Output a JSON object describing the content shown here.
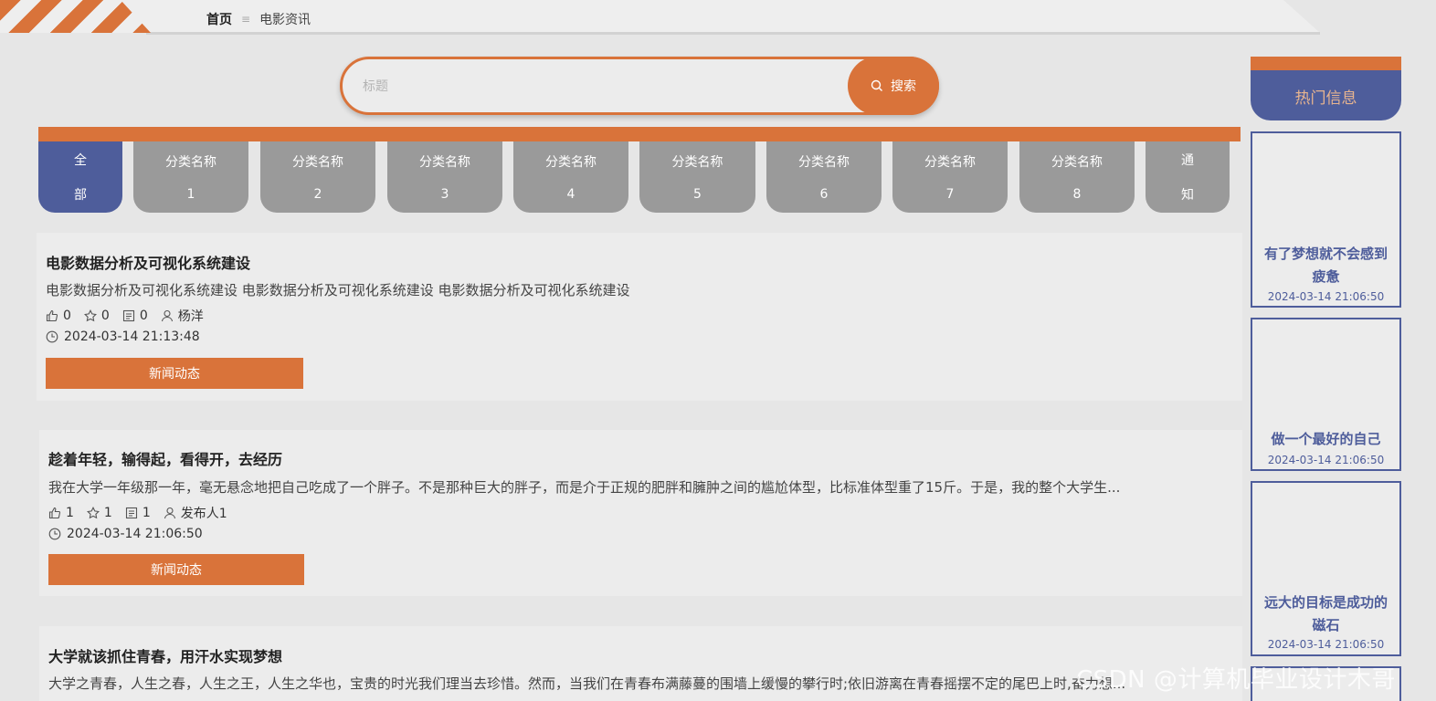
{
  "breadcrumb": {
    "home": "首页",
    "separator": "≡",
    "current": "电影资讯"
  },
  "search": {
    "placeholder": "标题",
    "button_label": "搜索"
  },
  "categories": [
    {
      "line1": "全",
      "line2": "部",
      "active": true
    },
    {
      "line1": "分类名称",
      "line2": "1"
    },
    {
      "line1": "分类名称",
      "line2": "2"
    },
    {
      "line1": "分类名称",
      "line2": "3"
    },
    {
      "line1": "分类名称",
      "line2": "4"
    },
    {
      "line1": "分类名称",
      "line2": "5"
    },
    {
      "line1": "分类名称",
      "line2": "6"
    },
    {
      "line1": "分类名称",
      "line2": "7"
    },
    {
      "line1": "分类名称",
      "line2": "8"
    },
    {
      "line1": "通",
      "line2": "知"
    }
  ],
  "news": [
    {
      "title": "电影数据分析及可视化系统建设",
      "desc": "电影数据分析及可视化系统建设 电影数据分析及可视化系统建设 电影数据分析及可视化系统建设",
      "likes": "0",
      "favorites": "0",
      "comments": "0",
      "author": "杨洋",
      "time": "2024-03-14 21:13:48",
      "button": "新闻动态"
    },
    {
      "title": "趁着年轻，输得起，看得开，去经历",
      "desc": "我在大学一年级那一年，毫无悬念地把自己吃成了一个胖子。不是那种巨大的胖子，而是介于正规的肥胖和臃肿之间的尴尬体型，比标准体型重了15斤。于是，我的整个大学生...",
      "likes": "1",
      "favorites": "1",
      "comments": "1",
      "author": "发布人1",
      "time": "2024-03-14 21:06:50",
      "button": "新闻动态"
    },
    {
      "title": "大学就该抓住青春，用汗水实现梦想",
      "desc": "大学之青春，人生之春，人生之王，人生之华也，宝贵的时光我们理当去珍惜。然而，当我们在青春布满藤蔓的围墙上缓慢的攀行时;依旧游离在青春摇摆不定的尾巴上时,奋力想..."
    }
  ],
  "sidebar": {
    "header": "热门信息",
    "items": [
      {
        "title": "有了梦想就不会感到疲惫",
        "date": "2024-03-14 21:06:50"
      },
      {
        "title": "做一个最好的自己",
        "date": "2024-03-14 21:06:50"
      },
      {
        "title": "远大的目标是成功的磁石",
        "date": "2024-03-14 21:06:50"
      }
    ]
  },
  "watermark": "CSDN @计算机毕业设计木哥",
  "colors": {
    "accent": "#d9733a",
    "primary": "#4e5d9b",
    "tab_inactive": "#9a9a9a"
  }
}
